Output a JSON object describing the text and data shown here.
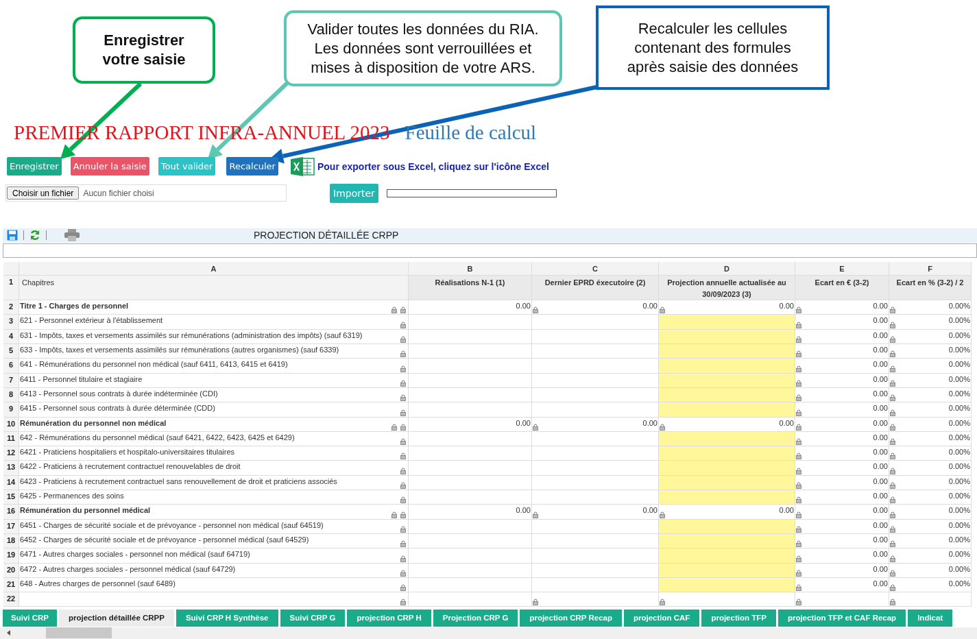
{
  "callouts": [
    {
      "kind": "emphasis",
      "color": "#00b050",
      "lines": [
        "Enregistrer",
        "votre saisie"
      ]
    },
    {
      "kind": "note",
      "color": "#5ec7b3",
      "lines": [
        "Valider toutes les données du RIA.",
        "Les données sont verrouillées et",
        "mises à disposition de votre ARS."
      ]
    },
    {
      "kind": "frame",
      "color": "#0b63b8",
      "lines": [
        "Recalculer les cellules",
        "contenant des formules",
        "après saisie des données"
      ]
    }
  ],
  "title": {
    "main": "PREMIER RAPPORT INFRA-ANNUEL 2023",
    "sub": "Feuille de calcul"
  },
  "buttons": [
    {
      "kind": "save",
      "label": "Enregistrer"
    },
    {
      "kind": "cancel",
      "label": "Annuler la saisie"
    },
    {
      "kind": "validate",
      "label": "Tout valider"
    },
    {
      "kind": "recalc",
      "label": "Recalculer"
    }
  ],
  "excel_link": "Pour exporter sous Excel, cliquez sur l'icône Excel",
  "file_input": {
    "button": "Choisir un fichier",
    "status": "Aucun fichier choisi"
  },
  "import_button": "Importer",
  "progress": {
    "level": 0
  },
  "sheet": {
    "title": "PROJECTION DÉTAILLÉE CRPP",
    "column_letters": [
      "A",
      "B",
      "C",
      "D",
      "E",
      "F"
    ],
    "header_row": {
      "number": "1",
      "cells": [
        "Chapitres",
        "Réalisations N-1 (1)",
        "Dernier EPRD éxecutoire (2)",
        "Projection annuelle actualisée au 30/09/2023 (3)",
        "Ecart en € (3-2)",
        "Ecart en % (3-2) / 2"
      ]
    },
    "rows": [
      {
        "number": "2",
        "kind": "section",
        "label": "Titre 1 - Charges de personnel",
        "b": "0.00",
        "c": "0.00",
        "d": "0.00",
        "e": "0.00",
        "f": "0.00%"
      },
      {
        "number": "3",
        "kind": "line",
        "label": "621 - Personnel extérieur à l'établissement",
        "e": "0.00",
        "f": "0.00%"
      },
      {
        "number": "4",
        "kind": "line",
        "label": "631 - Impôts, taxes et versements assimilés sur rémunérations (administration des impôts) (sauf 6319)",
        "e": "0.00",
        "f": "0.00%"
      },
      {
        "number": "5",
        "kind": "line",
        "label": "633 - Impôts, taxes et versements assimilés sur rémunérations (autres organismes) (sauf 6339)",
        "e": "0.00",
        "f": "0.00%"
      },
      {
        "number": "6",
        "kind": "line",
        "label": "641 - Rémunérations du personnel non médical (sauf 6411, 6413, 6415 et 6419)",
        "e": "0.00",
        "f": "0.00%"
      },
      {
        "number": "7",
        "kind": "line",
        "label": "6411 - Personnel titulaire et stagiaire",
        "e": "0.00",
        "f": "0.00%"
      },
      {
        "number": "8",
        "kind": "line",
        "label": "6413 - Personnel sous contrats à durée indéterminée (CDI)",
        "e": "0.00",
        "f": "0.00%"
      },
      {
        "number": "9",
        "kind": "line",
        "label": "6415 - Personnel sous contrats à durée déterminée (CDD)",
        "e": "0.00",
        "f": "0.00%"
      },
      {
        "number": "10",
        "kind": "section",
        "label": "Rémunération du personnel non médical",
        "b": "0.00",
        "c": "0.00",
        "d": "0.00",
        "e": "0.00",
        "f": "0.00%"
      },
      {
        "number": "11",
        "kind": "line",
        "label": "642 - Rémunérations du personnel médical (sauf 6421, 6422, 6423, 6425 et 6429)",
        "e": "0.00",
        "f": "0.00%"
      },
      {
        "number": "12",
        "kind": "line",
        "label": "6421 - Praticiens hospitaliers et hospitalo-universitaires titulaires",
        "e": "0.00",
        "f": "0.00%"
      },
      {
        "number": "13",
        "kind": "line",
        "label": "6422 - Praticiens à recrutement contractuel renouvelables de droit",
        "e": "0.00",
        "f": "0.00%"
      },
      {
        "number": "14",
        "kind": "line",
        "label": "6423 - Praticiens à recrutement contractuel sans renouvellement de droit et praticiens associés",
        "e": "0.00",
        "f": "0.00%"
      },
      {
        "number": "15",
        "kind": "line",
        "label": "6425 - Permanences des soins",
        "e": "0.00",
        "f": "0.00%"
      },
      {
        "number": "16",
        "kind": "section",
        "label": "Rémunération du personnel médical",
        "b": "0.00",
        "c": "0.00",
        "d": "0.00",
        "e": "0.00",
        "f": "0.00%"
      },
      {
        "number": "17",
        "kind": "line",
        "label": "6451 - Charges de sécurité sociale et de prévoyance - personnel non médical (sauf 64519)",
        "e": "0.00",
        "f": "0.00%"
      },
      {
        "number": "18",
        "kind": "line",
        "label": "6452 - Charges de sécurité sociale et de prévoyance - personnel médical (sauf 64529)",
        "e": "0.00",
        "f": "0.00%"
      },
      {
        "number": "19",
        "kind": "line",
        "label": "6471 - Autres charges sociales - personnel non médical (sauf 64719)",
        "e": "0.00",
        "f": "0.00%"
      },
      {
        "number": "20",
        "kind": "line",
        "label": "6472 - Autres charges sociales - personnel médical (sauf 64729)",
        "e": "0.00",
        "f": "0.00%"
      },
      {
        "number": "21",
        "kind": "line",
        "label": "648 - Autres charges de personnel (sauf 6489)",
        "e": "0.00",
        "f": "0.00%"
      },
      {
        "number": "22",
        "kind": "empty"
      }
    ]
  },
  "tabs": [
    {
      "label": "Suivi CRP",
      "selected": false
    },
    {
      "label": "projection détaillée CRPP",
      "selected": true
    },
    {
      "label": "Suivi CRP H Synthèse",
      "selected": false
    },
    {
      "label": "Suivi CRP G",
      "selected": false
    },
    {
      "label": "projection CRP H",
      "selected": false
    },
    {
      "label": "Projection CRP G",
      "selected": false
    },
    {
      "label": "projection CRP Recap",
      "selected": false
    },
    {
      "label": "projection CAF",
      "selected": false
    },
    {
      "label": "projection TFP",
      "selected": false
    },
    {
      "label": "projection TFP et CAF Recap",
      "selected": false
    },
    {
      "label": "Indicat",
      "selected": false
    }
  ]
}
